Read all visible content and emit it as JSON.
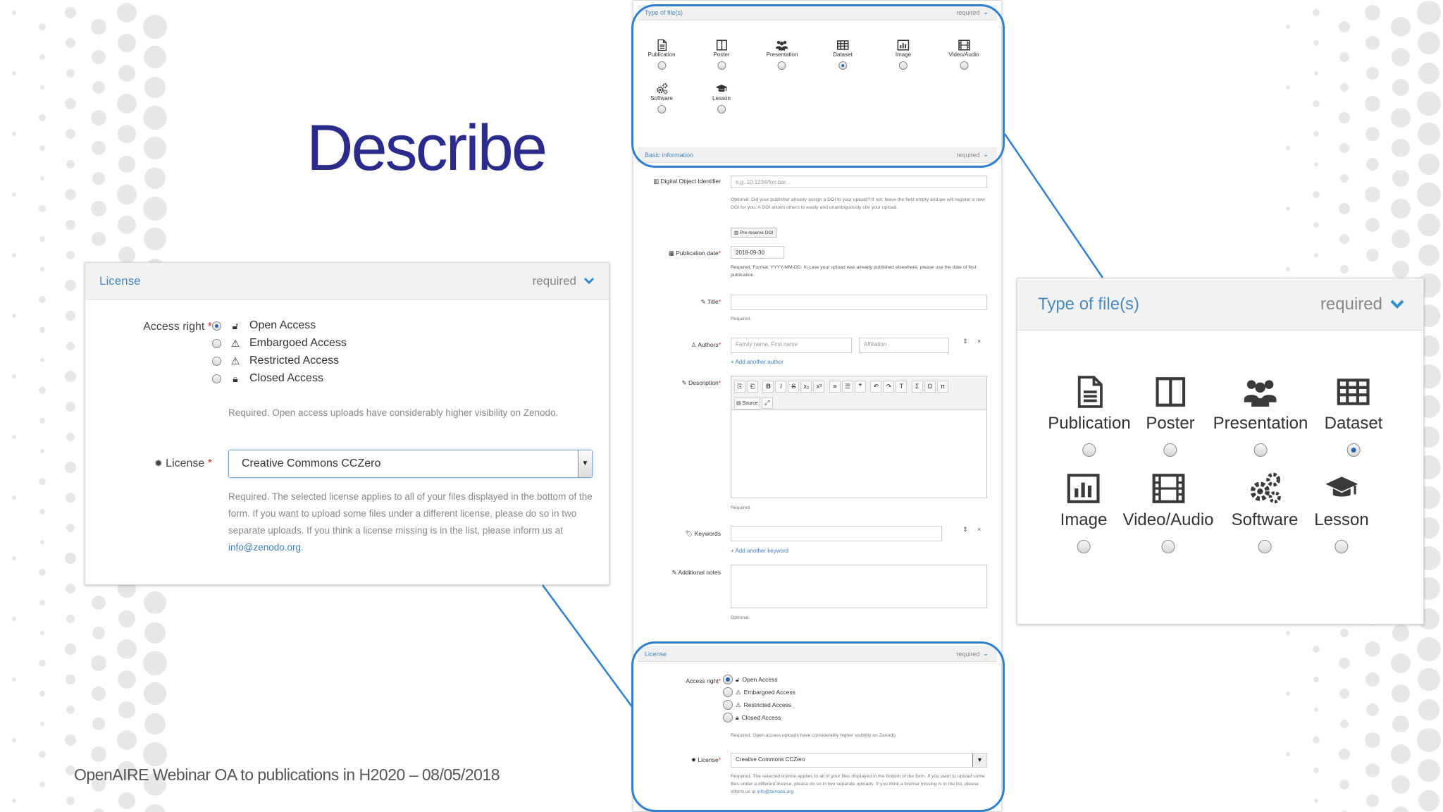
{
  "slide": {
    "title": "Describe",
    "footer": "OpenAIRE Webinar OA to publications in H2020 – 08/05/2018"
  },
  "license_panel": {
    "title": "License",
    "required": "required",
    "access_label": "Access right",
    "options": [
      {
        "label": "Open Access",
        "icon": "unlock-icon",
        "selected": true
      },
      {
        "label": "Embargoed Access",
        "icon": "warning-icon",
        "selected": false
      },
      {
        "label": "Restricted Access",
        "icon": "warning-icon",
        "selected": false
      },
      {
        "label": "Closed Access",
        "icon": "lock-icon",
        "selected": false
      }
    ],
    "access_help": "Required. Open access uploads have considerably higher visibility on Zenodo.",
    "license_label": "License",
    "license_value": "Creative Commons CCZero",
    "license_help": "Required. The selected license applies to all of your files displayed in the bottom of the form. If you want to upload some files under a different license, please do so in two separate uploads. If you think a license missing is in the list, please inform us at",
    "license_email": "info@zenodo.org",
    "license_help_end": "."
  },
  "type_panel": {
    "title": "Type of file(s)",
    "required": "required",
    "items": [
      {
        "label": "Publication",
        "icon": "file-text-icon",
        "selected": false
      },
      {
        "label": "Poster",
        "icon": "columns-icon",
        "selected": false
      },
      {
        "label": "Presentation",
        "icon": "users-icon",
        "selected": false
      },
      {
        "label": "Dataset",
        "icon": "table-icon",
        "selected": true
      },
      {
        "label": "Image",
        "icon": "bar-chart-icon",
        "selected": false
      },
      {
        "label": "Video/Audio",
        "icon": "film-icon",
        "selected": false
      },
      {
        "label": "Software",
        "icon": "cogs-icon",
        "selected": false
      },
      {
        "label": "Lesson",
        "icon": "graduation-cap-icon",
        "selected": false
      }
    ]
  },
  "form": {
    "type_header": "Type of file(s)",
    "basic_header": "Basic information",
    "license_header": "License",
    "required": "required",
    "doi_label": "Digital Object Identifier",
    "doi_placeholder": "e.g. 10.1234/foo.bar...",
    "doi_help": "Optional. Did your publisher already assign a DOI to your upload? If not, leave the field empty and we will register a new DOI for you. A DOI allows others to easily and unambiguously cite your upload.",
    "doi_button": "Pre-reserve DOI",
    "pubdate_label": "Publication date",
    "pubdate_value": "2018-09-30",
    "pubdate_help": "Required. Format: YYYY-MM-DD. In case your upload was already published elsewhere, please use the date of first publication.",
    "title_label": "Title",
    "title_help": "Required.",
    "authors_label": "Authors",
    "authors_name_placeholder": "Family name, First name",
    "authors_aff_placeholder": "Affiliation",
    "add_author": "+ Add another author",
    "description_label": "Description",
    "description_help": "Required.",
    "source_button": "Source",
    "keywords_label": "Keywords",
    "add_keyword": "+ Add another keyword",
    "notes_label": "Additional notes",
    "notes_help": "Optional.",
    "access_label": "Access right",
    "access_options": [
      "Open Access",
      "Embargoed Access",
      "Restricted Access",
      "Closed Access"
    ],
    "access_help": "Required. Open access uploads have considerably higher visibility on Zenodo.",
    "license_label": "License",
    "license_value": "Creative Commons CCZero",
    "license_help": "Required. The selected license applies to all of your files displayed in the bottom of the form. If you want to upload some files under a different license, please do so in two separate uploads. If you think a license missing is in the list, please inform us at",
    "license_email": "info@zenodo.org"
  },
  "colors": {
    "title": "#2b2b8c",
    "accent": "#2f7fce",
    "panel_title": "#4a8bbf"
  }
}
